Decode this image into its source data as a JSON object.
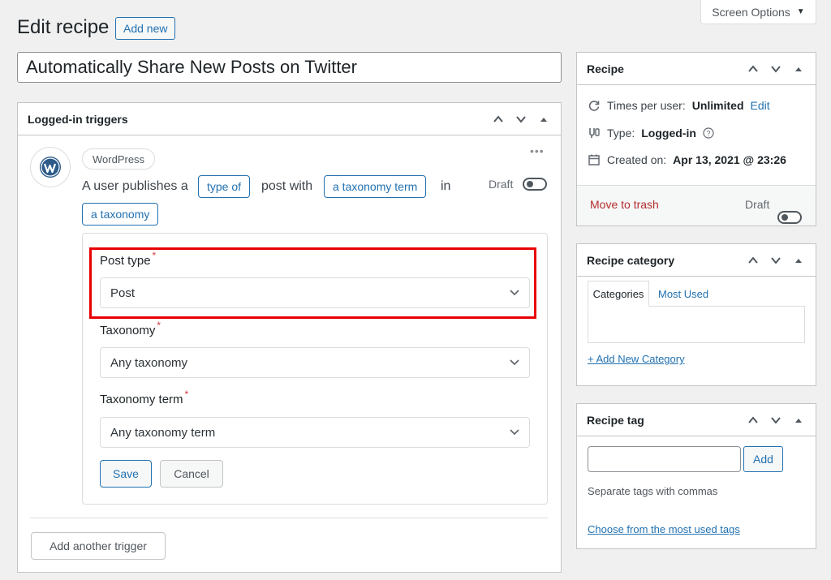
{
  "screen_options": {
    "label": "Screen Options"
  },
  "header": {
    "title": "Edit recipe",
    "add_new_label": "Add new"
  },
  "title_input": {
    "value": "Automatically Share New Posts on Twitter"
  },
  "triggers": {
    "heading": "Logged-in triggers",
    "integration_badge": "WordPress",
    "sentence": {
      "part1": "A user publishes a",
      "token1": "type of",
      "part2": "post with",
      "token2": "a taxonomy term",
      "part3": "in",
      "token3": "a taxonomy"
    },
    "status_label": "Draft",
    "fields": [
      {
        "label": "Post type",
        "required": "*",
        "value": "Post"
      },
      {
        "label": "Taxonomy",
        "required": "*",
        "value": "Any taxonomy"
      },
      {
        "label": "Taxonomy term",
        "required": "*",
        "value": "Any taxonomy term"
      }
    ],
    "save_label": "Save",
    "cancel_label": "Cancel",
    "add_trigger_label": "Add another trigger"
  },
  "recipe_box": {
    "heading": "Recipe",
    "times_label": "Times per user:",
    "times_value": "Unlimited",
    "edit_link": "Edit",
    "type_label": "Type:",
    "type_value": "Logged-in",
    "created_label": "Created on:",
    "created_value": "Apr 13, 2021 @ 23:26",
    "trash_label": "Move to trash",
    "status_label": "Draft"
  },
  "category_box": {
    "heading": "Recipe category",
    "tabs": [
      "Categories",
      "Most Used"
    ],
    "add_link": "+ Add New Category"
  },
  "tag_box": {
    "heading": "Recipe tag",
    "add_label": "Add",
    "hint": "Separate tags with commas",
    "choose_link": "Choose from the most used tags"
  },
  "colors": {
    "accent": "#2271b1",
    "highlight": "#e80000",
    "trash": "#b32d2e",
    "background": "#f0f0f1"
  }
}
